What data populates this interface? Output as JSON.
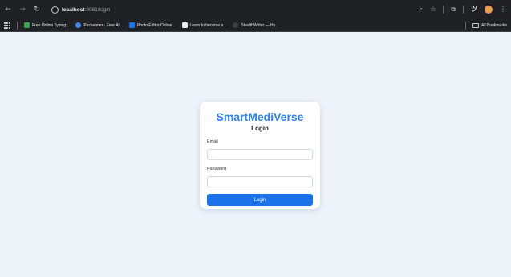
{
  "browser": {
    "url_host": "localhost",
    "url_path": ":8081/login",
    "bookmarks": [
      {
        "label": "Free Online Typing...",
        "favicon_color": "#34a853",
        "favicon": "check-icon"
      },
      {
        "label": "Packeaner · Free AI...",
        "favicon_color": "#4285f4",
        "favicon": "circle-icon"
      },
      {
        "label": "Photo Editor Online...",
        "favicon_color": "#1a73e8",
        "favicon": "photo-icon"
      },
      {
        "label": "Learn to become a...",
        "favicon_color": "#e8eaed",
        "favicon": "book-icon"
      },
      {
        "label": "StealthWriter — Hu...",
        "favicon_color": "#3c4043",
        "favicon": "dot-icon"
      }
    ],
    "all_bookmarks_label": "All Bookmarks"
  },
  "login_card": {
    "brand": "SmartMediVerse",
    "title": "Login",
    "email_label": "Email",
    "email_value": "",
    "password_label": "Password",
    "password_value": "",
    "submit_label": "Login",
    "accent_color": "#1a73e8"
  }
}
